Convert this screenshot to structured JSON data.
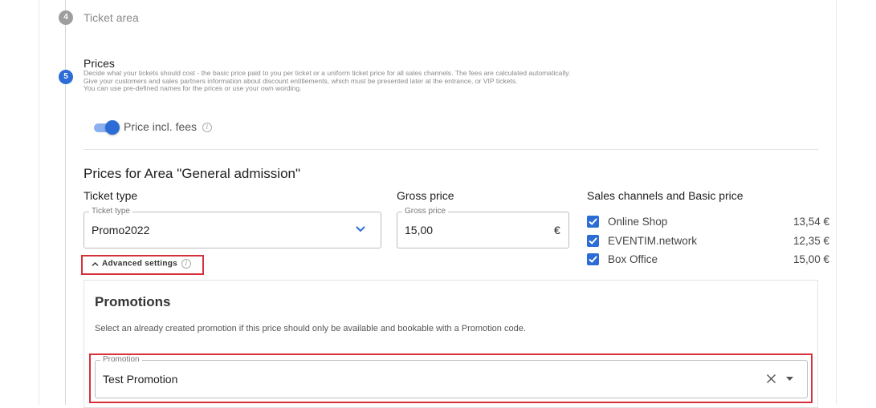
{
  "steps": {
    "step4": {
      "number": "4",
      "label": "Ticket area"
    },
    "step5": {
      "number": "5",
      "title": "Prices",
      "description_lines": [
        "Decide what your tickets should cost - the basic price paid to you per ticket or a uniform ticket price for all sales channels. The fees are calculated automatically.",
        "Give your customers and sales partners information about discount entitlements, which must be presented later at the entrance, or VIP tickets.",
        "You can use pre-defined names for the prices or use your own wording."
      ]
    }
  },
  "toggle": {
    "label": "Price incl. fees",
    "on": true,
    "info_icon": "info-icon"
  },
  "area": {
    "heading": "Prices for Area \"General admission\"",
    "columns": {
      "ticket_type": "Ticket type",
      "gross_price": "Gross price",
      "sales_channels": "Sales channels and Basic price"
    },
    "ticket_type_field": {
      "legend": "Ticket type",
      "value": "Promo2022",
      "icon": "chevron-down-icon"
    },
    "gross_price_field": {
      "legend": "Gross price",
      "value": "15,00",
      "currency": "€"
    },
    "sales_channels": [
      {
        "name": "Online Shop",
        "price": "13,54 €",
        "checked": true
      },
      {
        "name": "EVENTIM.network",
        "price": "12,35 €",
        "checked": true
      },
      {
        "name": "Box Office",
        "price": "15,00 €",
        "checked": true
      }
    ],
    "advanced_settings": {
      "label": "Advanced settings",
      "expanded": true
    }
  },
  "promotions": {
    "title": "Promotions",
    "description": "Select an already created promotion if this price should only be available and bookable with a Promotion code.",
    "field": {
      "legend": "Promotion",
      "value": "Test Promotion",
      "clear_icon": "close-icon",
      "dropdown_icon": "caret-down-icon"
    }
  },
  "colors": {
    "accent": "#2c6cd6",
    "highlight": "#d8303a",
    "muted": "#8a8a8a"
  }
}
